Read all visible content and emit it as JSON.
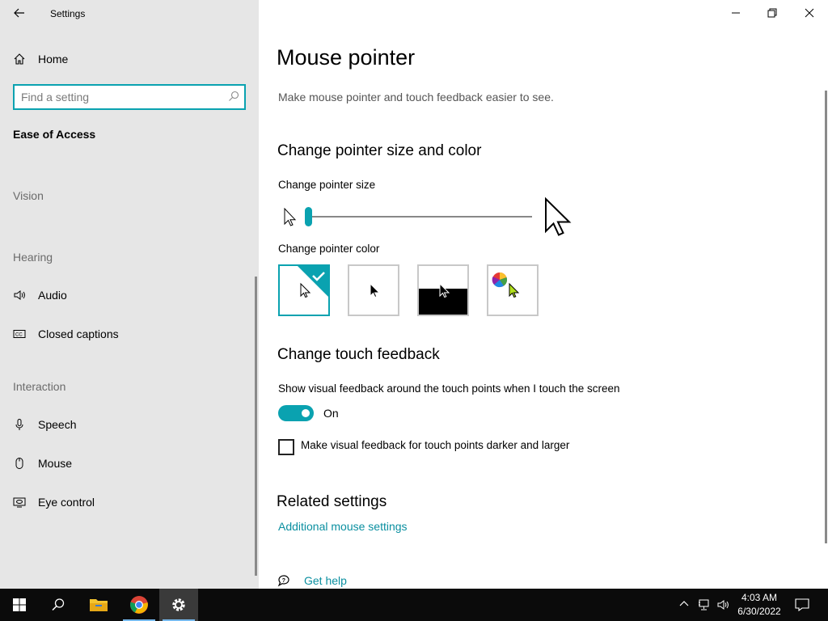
{
  "window": {
    "title": "Settings"
  },
  "sidebar": {
    "home_label": "Home",
    "search_placeholder": "Find a setting",
    "category_title": "Ease of Access",
    "groups": {
      "vision": "Vision",
      "hearing": "Hearing",
      "interaction": "Interaction"
    },
    "items": {
      "audio": "Audio",
      "closed_captions": "Closed captions",
      "speech": "Speech",
      "mouse": "Mouse",
      "eye_control": "Eye control"
    }
  },
  "main": {
    "title": "Mouse pointer",
    "description": "Make mouse pointer and touch feedback easier to see.",
    "pointer_section_title": "Change pointer size and color",
    "pointer_size_label": "Change pointer size",
    "pointer_size_value": 1,
    "pointer_color_label": "Change pointer color",
    "pointer_color_options": [
      "white",
      "black",
      "inverted",
      "custom"
    ],
    "pointer_color_selected": "white",
    "touch_section_title": "Change touch feedback",
    "touch_feedback_label": "Show visual feedback around the touch points when I touch the screen",
    "touch_toggle_state": "On",
    "darker_checkbox_label": "Make visual feedback for touch points darker and larger",
    "darker_checkbox_checked": false,
    "related_title": "Related settings",
    "related_link": "Additional mouse settings",
    "help_link": "Get help"
  },
  "taskbar": {
    "time": "4:03 AM",
    "date": "6/30/2022",
    "apps": [
      "start-icon",
      "search-icon",
      "file-explorer-icon",
      "chrome-icon",
      "settings-icon"
    ]
  },
  "colors": {
    "accent": "#0aa2b0",
    "sidebar_bg": "#e6e6e6",
    "taskbar_bg": "#0b0b0b"
  }
}
